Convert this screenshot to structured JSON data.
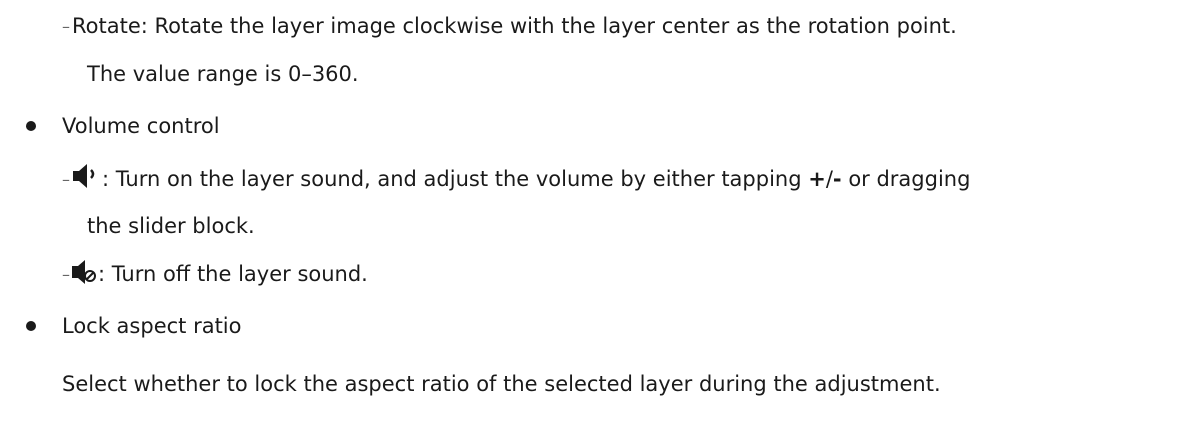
{
  "rotate": {
    "dash": "–",
    "line1": "Rotate: Rotate the layer image clockwise with the layer center as the rotation point.",
    "line2": "The value range is 0–360."
  },
  "volume": {
    "heading": "Volume control",
    "on": {
      "dash": "–",
      "icon": "speaker-on-icon",
      "text_before": ": Turn on the layer sound, and adjust the volume by either tapping ",
      "bold": "+",
      "slash": "/",
      "bold2": "-",
      "text_after": " or dragging",
      "line2": "the slider block."
    },
    "off": {
      "dash": "–",
      "icon": "speaker-mute-icon",
      "text": ": Turn off the layer sound."
    }
  },
  "lock": {
    "heading": "Lock aspect ratio",
    "description": "Select whether to lock the aspect ratio of the selected layer during the adjustment."
  }
}
